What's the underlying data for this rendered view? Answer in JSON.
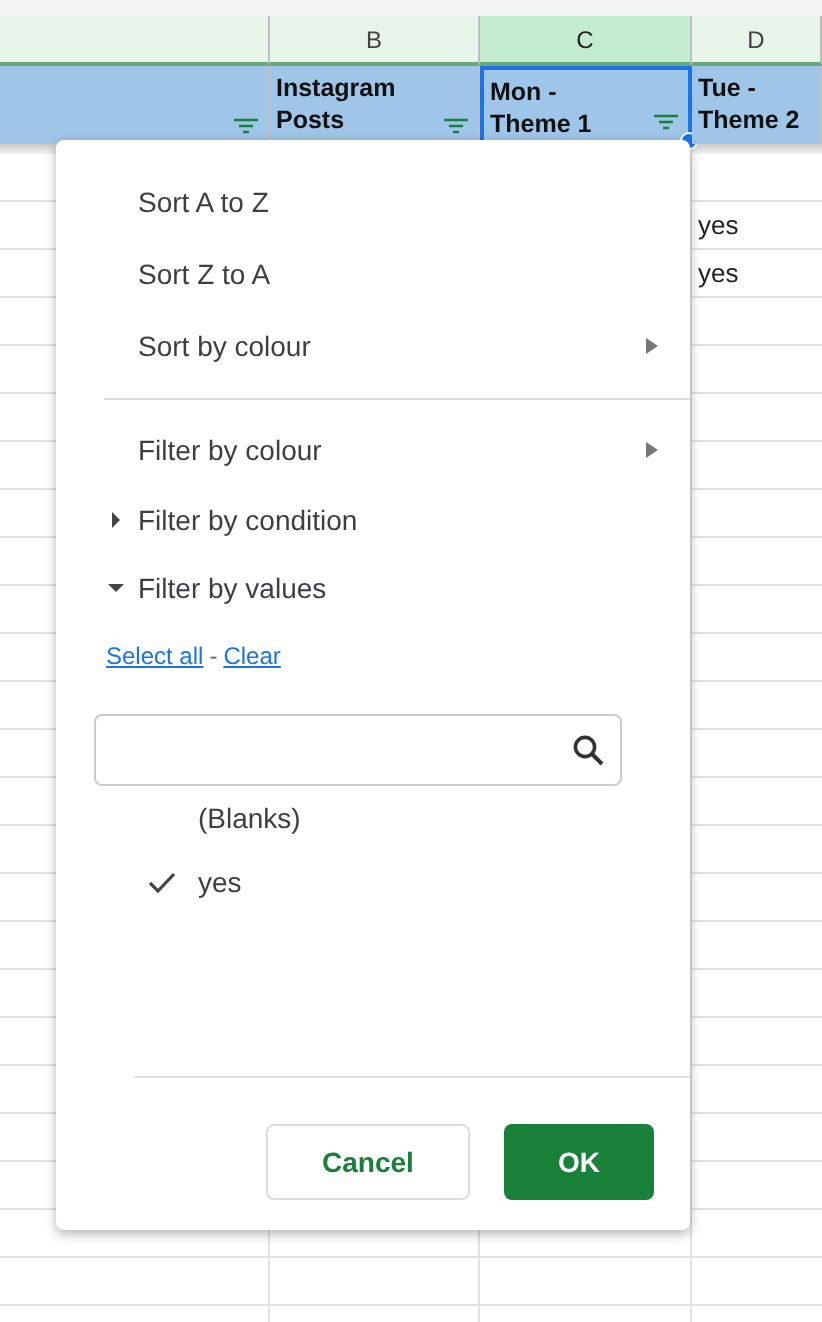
{
  "columns": [
    {
      "selected": false
    },
    {
      "letter": "B",
      "selected": false
    },
    {
      "letter": "C",
      "selected": true
    },
    {
      "letter": "D",
      "selected": false
    }
  ],
  "header_row": [
    {
      "has_filter": true,
      "selected": false
    },
    {
      "text": "Instagram Posts",
      "has_filter": true,
      "selected": false
    },
    {
      "text": "Mon - Theme 1",
      "has_filter": true,
      "selected": true
    },
    {
      "text": "Tue - Theme 2",
      "has_filter": false,
      "selected": false
    }
  ],
  "rows": [
    {},
    {
      "column_d": "yes"
    },
    {
      "column_d": "yes"
    }
  ],
  "filter_menu": {
    "items": [
      {
        "kind": "action",
        "label": "Sort A to Z",
        "divider_before": false
      },
      {
        "kind": "action",
        "label": "Sort Z to A",
        "divider_before": false
      },
      {
        "kind": "submenu",
        "label": "Sort by colour",
        "divider_before": false
      },
      {
        "kind": "submenu",
        "label": "Filter by colour",
        "divider_before": true
      },
      {
        "kind": "section",
        "label": "Filter by condition",
        "expanded": false,
        "divider_before": false
      },
      {
        "kind": "section",
        "label": "Filter by values",
        "expanded": true,
        "divider_before": false
      }
    ],
    "links": [
      "Select all",
      "Clear"
    ],
    "link_separator": "-",
    "values": [
      {
        "label": "(Blanks)",
        "checked": false
      },
      {
        "label": "yes",
        "checked": true
      }
    ],
    "buttons": [
      {
        "label": "Cancel",
        "kind": "secondary"
      },
      {
        "label": "OK",
        "kind": "primary"
      }
    ]
  }
}
